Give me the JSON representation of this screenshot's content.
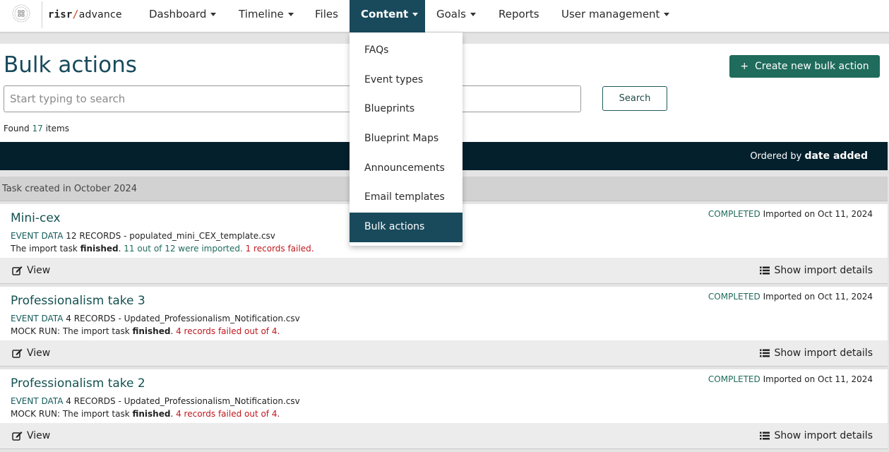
{
  "brand": {
    "risr": "risr",
    "slash": "/",
    "advance": "advance"
  },
  "nav": [
    {
      "label": "Dashboard",
      "has_caret": true
    },
    {
      "label": "Timeline",
      "has_caret": true
    },
    {
      "label": "Files",
      "has_caret": false
    },
    {
      "label": "Content",
      "has_caret": true,
      "active": true
    },
    {
      "label": "Goals",
      "has_caret": true
    },
    {
      "label": "Reports",
      "has_caret": false
    },
    {
      "label": "User management",
      "has_caret": true
    }
  ],
  "content_menu": {
    "items": [
      "FAQs",
      "Event types",
      "Blueprints",
      "Blueprint Maps",
      "Announcements",
      "Email templates",
      "Bulk actions"
    ],
    "selected": "Bulk actions"
  },
  "page": {
    "title": "Bulk actions",
    "create_button": "Create new bulk action",
    "create_icon": "plus-icon",
    "search_placeholder": "Start typing to search",
    "search_button": "Search",
    "found_prefix": "Found",
    "found_count": "17",
    "found_suffix": "items",
    "sort_prefix": "Ordered by",
    "sort_field": "date added"
  },
  "section": {
    "title": "Task created in October 2024"
  },
  "tasks": [
    {
      "title": "Mini-cex",
      "status": "COMPLETED",
      "imported": "Imported on Oct 11, 2024",
      "type": "EVENT DATA",
      "records": "12 RECORDS",
      "file": "- populated_mini_CEX_template.csv",
      "result_prefix": "The import task",
      "result_state": "finished",
      "result_ok": "11 out of 12 were imported.",
      "result_fail": "1 records failed."
    },
    {
      "title": "Professionalism take 3",
      "status": "COMPLETED",
      "imported": "Imported on Oct 11, 2024",
      "type": "EVENT DATA",
      "records": "4 RECORDS",
      "file": "- Updated_Professionalism_Notification.csv",
      "result_prefix": "MOCK RUN: The import task",
      "result_state": "finished",
      "result_ok": "",
      "result_fail": "4 records failed out of 4."
    },
    {
      "title": "Professionalism take 2",
      "status": "COMPLETED",
      "imported": "Imported on Oct 11, 2024",
      "type": "EVENT DATA",
      "records": "4 RECORDS",
      "file": "- Updated_Professionalism_Notification.csv",
      "result_prefix": "MOCK RUN: The import task",
      "result_state": "finished",
      "result_ok": "",
      "result_fail": "4 records failed out of 4."
    }
  ],
  "actions": {
    "view": "View",
    "details": "Show import details"
  },
  "colors": {
    "primary": "#194a5c",
    "accent": "#1f6b5c",
    "danger": "#c0171d",
    "dark_bar": "#05202d"
  }
}
